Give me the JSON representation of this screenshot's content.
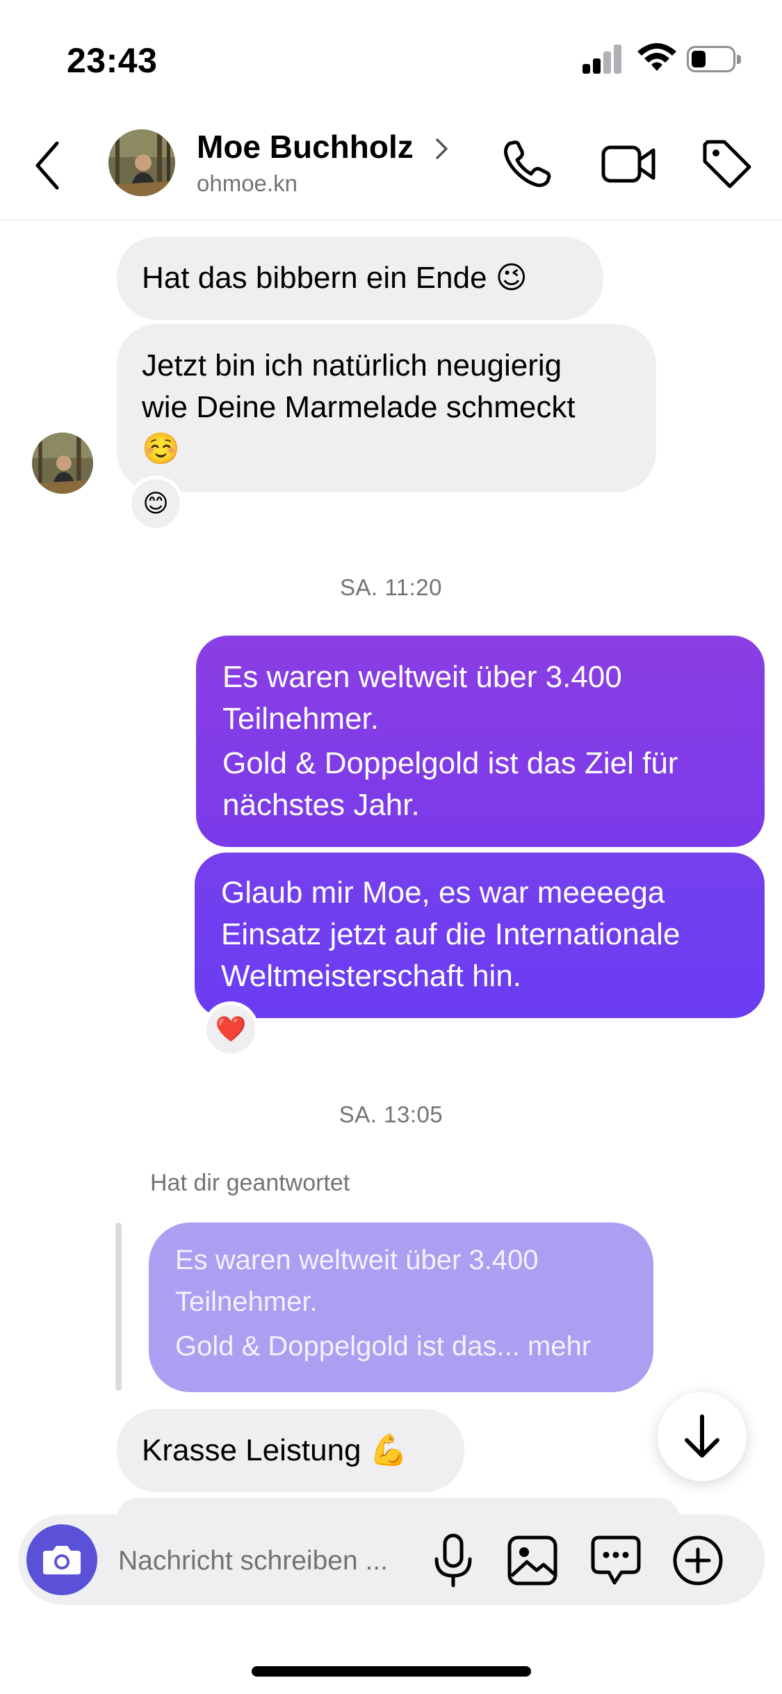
{
  "status_bar": {
    "time": "23:43",
    "battery_level": 0.25
  },
  "header": {
    "name": "Moe Buchholz",
    "username": "ohmoe.kn"
  },
  "messages": {
    "in1": "Hat das bibbern ein Ende 😉",
    "in2_l1": "Jetzt bin ich natürlich neugierig",
    "in2_l2": "wie Deine Marmelade schmeckt",
    "in2_l3": "☺️",
    "in2_reaction": "😊",
    "stamp1": "SA. 11:20",
    "out1_l1": "Es waren weltweit über 3.400",
    "out1_l2": "Teilnehmer.",
    "out1_l3": "Gold & Doppelgold ist das Ziel für",
    "out1_l4": "nächstes Jahr.",
    "out2_l1": "Glaub mir Moe, es war meeeega",
    "out2_l2": "Einsatz jetzt auf die Internationale",
    "out2_l3": "Weltmeisterschaft hin.",
    "out2_reaction": "❤️",
    "stamp2": "SA. 13:05",
    "reply_label": "Hat dir geantwortet",
    "reply_l1": "Es waren weltweit über 3.400",
    "reply_l2": "Teilnehmer.",
    "reply_l3": "Gold & Doppelgold ist das... mehr",
    "in3": "Krasse Leistung 💪"
  },
  "composer": {
    "placeholder": "Nachricht schreiben ..."
  },
  "icons": {
    "back": "chevron-left-icon",
    "call": "phone-icon",
    "video": "video-camera-icon",
    "tag": "tag-icon",
    "camera": "camera-icon",
    "mic": "microphone-icon",
    "gallery": "image-icon",
    "sticker": "chat-bubble-icon",
    "more": "plus-circle-icon",
    "scroll": "arrow-down-icon"
  },
  "colors": {
    "outgoing_top": "#8a3ee3",
    "outgoing_bottom": "#6b3cf0",
    "incoming": "#efeff1",
    "reply_bubble": "#ab9ff2",
    "camera_button": "#5b51d8",
    "muted_text": "#737373"
  }
}
